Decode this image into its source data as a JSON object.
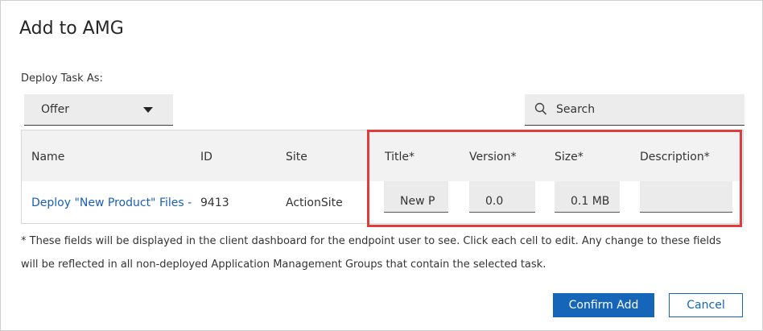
{
  "dialog": {
    "title": "Add to AMG"
  },
  "deploy": {
    "label": "Deploy Task As:",
    "selected": "Offer"
  },
  "search": {
    "placeholder": "Search"
  },
  "table": {
    "columns": [
      "Name",
      "ID",
      "Site",
      "Title*",
      "Version*",
      "Size*",
      "Description*"
    ],
    "row": {
      "name": "Deploy \"New Product\" Files - I",
      "id": "9413",
      "site": "ActionSite",
      "title": "New P",
      "version": "0.0",
      "size": "0.1 MB",
      "description": ""
    }
  },
  "note": "* These fields will be displayed in the client dashboard for the endpoint user to see. Click each cell to edit. Any change to these fields will be reflected in all non-deployed Application Management Groups that contain the selected task.",
  "buttons": {
    "confirm": "Confirm Add",
    "cancel": "Cancel"
  },
  "colors": {
    "primary": "#1565b8",
    "highlight": "#e03c3c",
    "link": "#1a5fb4"
  }
}
